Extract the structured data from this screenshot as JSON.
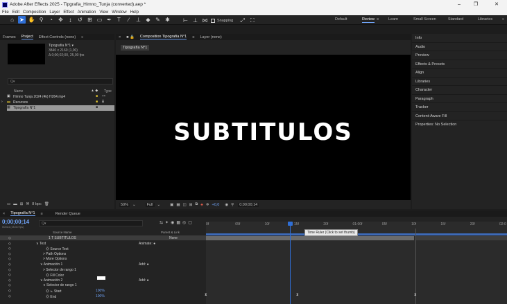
{
  "window": {
    "title": "Adobe After Effects 2025 - Tipgrafia_Himno_Tunja (converted).aep *",
    "min": "–",
    "max": "❐",
    "close": "✕"
  },
  "menu": [
    "File",
    "Edit",
    "Composition",
    "Layer",
    "Effect",
    "Animation",
    "View",
    "Window",
    "Help"
  ],
  "toolbar": {
    "snapping": "Snapping",
    "workspaces": [
      "Default",
      "Review",
      "Learn",
      "Small Screen",
      "Standard",
      "Libraries"
    ],
    "active_workspace": "Review"
  },
  "project_panel": {
    "tabs": [
      "Frames",
      "Project",
      "Effect Controls (none)"
    ],
    "thumb_name": "Tipografía N°1 ▾",
    "thumb_info1": "3840 x 2160 (1,00)",
    "thumb_info2": "Δ 0;00;02;00, 25,00 fps",
    "search_placeholder": "Q▾",
    "col_name": "Name",
    "col_type": "Type",
    "items": [
      {
        "name": "Himno Tunja 2024 (4k) H264.mp4"
      },
      {
        "name": "Recursos"
      },
      {
        "name": "Tipografía N°1"
      }
    ],
    "bpc": "8 bpc"
  },
  "comp_panel": {
    "tab": "Composition Tipografía N°1",
    "layer_tab": "Layer (none)",
    "comp_chip": "Tipografía N°1",
    "viewer_text": "SUBTITULOS",
    "zoom": "50%",
    "quality": "Full",
    "exposure": "+0,0",
    "timecode": "0;00;00;14"
  },
  "right_panel": [
    "Info",
    "Audio",
    "Preview",
    "Effects & Presets",
    "Align",
    "Libraries",
    "Character",
    "Paragraph",
    "Tracker",
    "Content-Aware Fill",
    "Properties: No Selection"
  ],
  "timeline": {
    "tab": "Tipografía N°1",
    "render_tab": "Render Queue",
    "timecode": "0;00;00;14",
    "timecode_sub": "00014 (25.00 fps)",
    "col_source": "Source Name",
    "col_parent": "Parent & Link",
    "parent_value": "None",
    "tooltip": "Time Ruler (Click to set thumb)",
    "ticks": [
      "0f",
      "05f",
      "10f",
      "15f",
      "20f",
      "01:00f",
      "05f",
      "10f",
      "15f",
      "20f",
      "02:0"
    ],
    "rows": [
      {
        "indent": 70,
        "label": "1   T  SUBTITULOS",
        "right": ""
      },
      {
        "indent": 52,
        "label": "∨ Text",
        "right": "Animate: ●"
      },
      {
        "indent": 66,
        "label": "Ⓞ Source Text",
        "right": ""
      },
      {
        "indent": 62,
        "label": "> Path Options",
        "right": ""
      },
      {
        "indent": 62,
        "label": "> More Options",
        "right": ""
      },
      {
        "indent": 58,
        "label": "∨ Animación 1",
        "right": "Add: ●"
      },
      {
        "indent": 62,
        "label": "> Selector de rango 1",
        "right": ""
      },
      {
        "indent": 66,
        "label": "Ⓞ Fill Color",
        "right": ""
      },
      {
        "indent": 58,
        "label": "∨ Animación 2",
        "right": "Add: ●"
      },
      {
        "indent": 62,
        "label": "∨ Selector de rango 1",
        "right": ""
      },
      {
        "indent": 66,
        "label": "Ⓞ ⊾ Start",
        "right": "100%"
      },
      {
        "indent": 66,
        "label": "Ⓞ End",
        "right": "100%"
      }
    ]
  }
}
